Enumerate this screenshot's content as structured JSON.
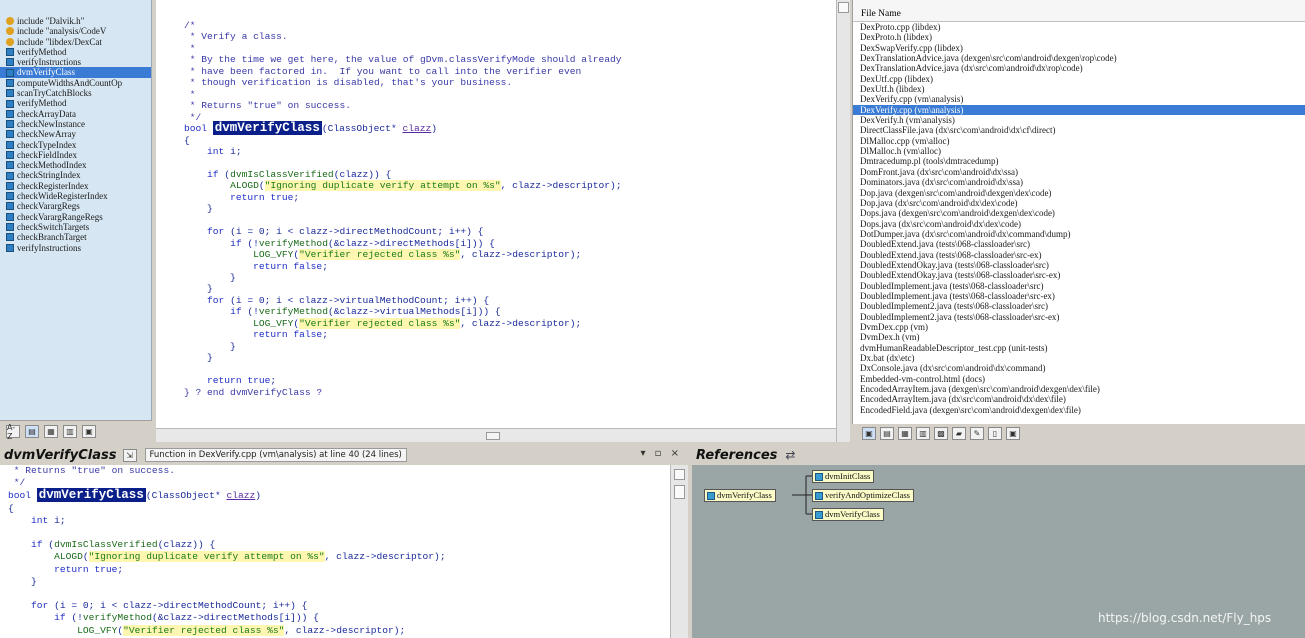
{
  "symbols": {
    "selected_index": 5,
    "items": [
      {
        "label": "include \"Dalvik.h\"",
        "kind": "include"
      },
      {
        "label": "include \"analysis/CodeV",
        "kind": "include"
      },
      {
        "label": "include \"libdex/DexCat",
        "kind": "include"
      },
      {
        "label": "verifyMethod",
        "kind": "function"
      },
      {
        "label": "verifyInstructions",
        "kind": "function"
      },
      {
        "label": "dvmVerifyClass",
        "kind": "function"
      },
      {
        "label": "computeWidthsAndCountOp",
        "kind": "function"
      },
      {
        "label": "scanTryCatchBlocks",
        "kind": "function"
      },
      {
        "label": "verifyMethod",
        "kind": "function"
      },
      {
        "label": "checkArrayData",
        "kind": "function"
      },
      {
        "label": "checkNewInstance",
        "kind": "function"
      },
      {
        "label": "checkNewArray",
        "kind": "function"
      },
      {
        "label": "checkTypeIndex",
        "kind": "function"
      },
      {
        "label": "checkFieldIndex",
        "kind": "function"
      },
      {
        "label": "checkMethodIndex",
        "kind": "function"
      },
      {
        "label": "checkStringIndex",
        "kind": "function"
      },
      {
        "label": "checkRegisterIndex",
        "kind": "function"
      },
      {
        "label": "checkWideRegisterIndex",
        "kind": "function"
      },
      {
        "label": "checkVarargRegs",
        "kind": "function"
      },
      {
        "label": "checkVarargRangeRegs",
        "kind": "function"
      },
      {
        "label": "checkSwitchTargets",
        "kind": "function"
      },
      {
        "label": "checkBranchTarget",
        "kind": "function"
      },
      {
        "label": "verifyInstructions",
        "kind": "function"
      }
    ],
    "toolbar_sort_label": "A-Z"
  },
  "editor": {
    "comment_lines": [
      "/*",
      " * Verify a class.",
      " *",
      " * By the time we get here, the value of gDvm.classVerifyMode should already",
      " * have been factored in.  If you want to call into the verifier even",
      " * though verification is disabled, that's your business.",
      " *",
      " * Returns \"true\" on success.",
      " */"
    ],
    "fn_name": "dvmVerifyClass",
    "end_comment": "} ? end dvmVerifyClass ?"
  },
  "files": {
    "header": "File Name",
    "selected_index": 8,
    "items": [
      "DexProto.cpp (libdex)",
      "DexProto.h (libdex)",
      "DexSwapVerify.cpp (libdex)",
      "DexTranslationAdvice.java (dexgen\\src\\com\\android\\dexgen\\rop\\code)",
      "DexTranslationAdvice.java (dx\\src\\com\\android\\dx\\rop\\code)",
      "DexUtf.cpp (libdex)",
      "DexUtf.h (libdex)",
      "DexVerify.cpp (vm\\analysis)",
      "DexVerify.cpp (vm\\analysis)",
      "DexVerify.h (vm\\analysis)",
      "DirectClassFile.java (dx\\src\\com\\android\\dx\\cf\\direct)",
      "DlMalloc.cpp (vm\\alloc)",
      "DlMalloc.h (vm\\alloc)",
      "Dmtracedump.pl (tools\\dmtracedump)",
      "DomFront.java (dx\\src\\com\\android\\dx\\ssa)",
      "Dominators.java (dx\\src\\com\\android\\dx\\ssa)",
      "Dop.java (dexgen\\src\\com\\android\\dexgen\\dex\\code)",
      "Dop.java (dx\\src\\com\\android\\dx\\dex\\code)",
      "Dops.java (dexgen\\src\\com\\android\\dexgen\\dex\\code)",
      "Dops.java (dx\\src\\com\\android\\dx\\dex\\code)",
      "DotDumper.java (dx\\src\\com\\android\\dx\\command\\dump)",
      "DoubledExtend.java (tests\\068-classloader\\src)",
      "DoubledExtend.java (tests\\068-classloader\\src-ex)",
      "DoubledExtendOkay.java (tests\\068-classloader\\src)",
      "DoubledExtendOkay.java (tests\\068-classloader\\src-ex)",
      "DoubledImplement.java (tests\\068-classloader\\src)",
      "DoubledImplement.java (tests\\068-classloader\\src-ex)",
      "DoubledImplement2.java (tests\\068-classloader\\src)",
      "DoubledImplement2.java (tests\\068-classloader\\src-ex)",
      "DvmDex.cpp (vm)",
      "DvmDex.h (vm)",
      "dvmHumanReadableDescriptor_test.cpp (unit-tests)",
      "Dx.bat (dx\\etc)",
      "DxConsole.java (dx\\src\\com\\android\\dx\\command)",
      "Embedded-vm-control.html (docs)",
      "EncodedArrayItem.java (dexgen\\src\\com\\android\\dexgen\\dex\\file)",
      "EncodedArrayItem.java (dx\\src\\com\\android\\dx\\dex\\file)",
      "EncodedField.java (dexgen\\src\\com\\android\\dexgen\\dex\\file)"
    ]
  },
  "context": {
    "title": "dvmVerifyClass",
    "info": "Function in DexVerify.cpp (vm\\analysis) at line 40 (24 lines)",
    "window_controls": "▾ ▫ ×"
  },
  "references": {
    "title": "References",
    "root": "dvmVerifyClass",
    "children": [
      "dvmInitClass",
      "verifyAndOptimizeClass",
      "dvmVerifyClass"
    ]
  },
  "watermark": "https://blog.csdn.net/Fly_hps"
}
